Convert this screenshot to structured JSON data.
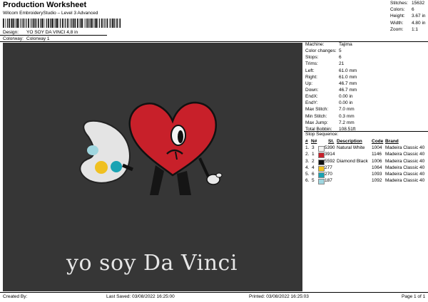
{
  "header": {
    "title": "Production Worksheet",
    "subtitle": "Wilcom EmbroideryStudio – Level 3 Advanced",
    "design_label": "Design:",
    "design_value": "YO SOY DA VINCI 4,8 in",
    "colorway_label": "Colorway:",
    "colorway_value": "Colorway 1"
  },
  "stats": [
    {
      "label": "Stitches:",
      "value": "15632"
    },
    {
      "label": "Colors:",
      "value": "6"
    },
    {
      "label": "Height:",
      "value": "3.67 in"
    },
    {
      "label": "Width:",
      "value": "4.80 in"
    },
    {
      "label": "Zoom:",
      "value": "1:1"
    }
  ],
  "design_text": "yo soy Da Vinci",
  "machine_params": [
    {
      "label": "Machine:",
      "value": "Tajima"
    },
    {
      "label": "Color changes:",
      "value": "5"
    },
    {
      "label": "Stops:",
      "value": "6"
    },
    {
      "label": "Trims:",
      "value": "21"
    },
    {
      "label": "Left:",
      "value": "61.0 mm"
    },
    {
      "label": "Right:",
      "value": "61.0 mm"
    },
    {
      "label": "Up:",
      "value": "46.7 mm"
    },
    {
      "label": "Down:",
      "value": "46.7 mm"
    },
    {
      "label": "EndX:",
      "value": "0.00 in"
    },
    {
      "label": "EndY:",
      "value": "0.00 in"
    },
    {
      "label": "Max Stitch:",
      "value": "7.0 mm"
    },
    {
      "label": "Min Stitch:",
      "value": "0.3 mm"
    },
    {
      "label": "Max Jump:",
      "value": "7.2 mm"
    },
    {
      "label": "Total Bobbin:",
      "value": "108.51ft"
    }
  ],
  "stop_sequence": {
    "title": "Stop Sequence:",
    "headers": {
      "num": "#",
      "n": "N#",
      "st": "St.",
      "desc": "Description",
      "code": "Code",
      "brand": "Brand"
    },
    "rows": [
      {
        "num": "1.",
        "n": "3",
        "color": "#f2f2f2",
        "st": "5390",
        "desc": "Natural White",
        "code": "1004",
        "brand": "Madeira Classic 40"
      },
      {
        "num": "2.",
        "n": "1",
        "color": "#c8202a",
        "st": "3914",
        "desc": "",
        "code": "1146",
        "brand": "Madeira Classic 40"
      },
      {
        "num": "3.",
        "n": "2",
        "color": "#111111",
        "st": "5592",
        "desc": "Diamond Black",
        "code": "1006",
        "brand": "Madeira Classic 40"
      },
      {
        "num": "4.",
        "n": "4",
        "color": "#f0c020",
        "st": "277",
        "desc": "",
        "code": "1064",
        "brand": "Madeira Classic 40"
      },
      {
        "num": "5.",
        "n": "6",
        "color": "#1aa3b3",
        "st": "270",
        "desc": "",
        "code": "1093",
        "brand": "Madeira Classic 40"
      },
      {
        "num": "6.",
        "n": "5",
        "color": "#9fd6df",
        "st": "187",
        "desc": "",
        "code": "1092",
        "brand": "Madeira Classic 40"
      }
    ]
  },
  "footer": {
    "created_by": "Created By:",
    "last_saved": "Last Saved: 03/08/2022 16:25:00",
    "printed": "Printed: 03/08/2022 16:25:03",
    "page": "Page 1 of 1"
  }
}
